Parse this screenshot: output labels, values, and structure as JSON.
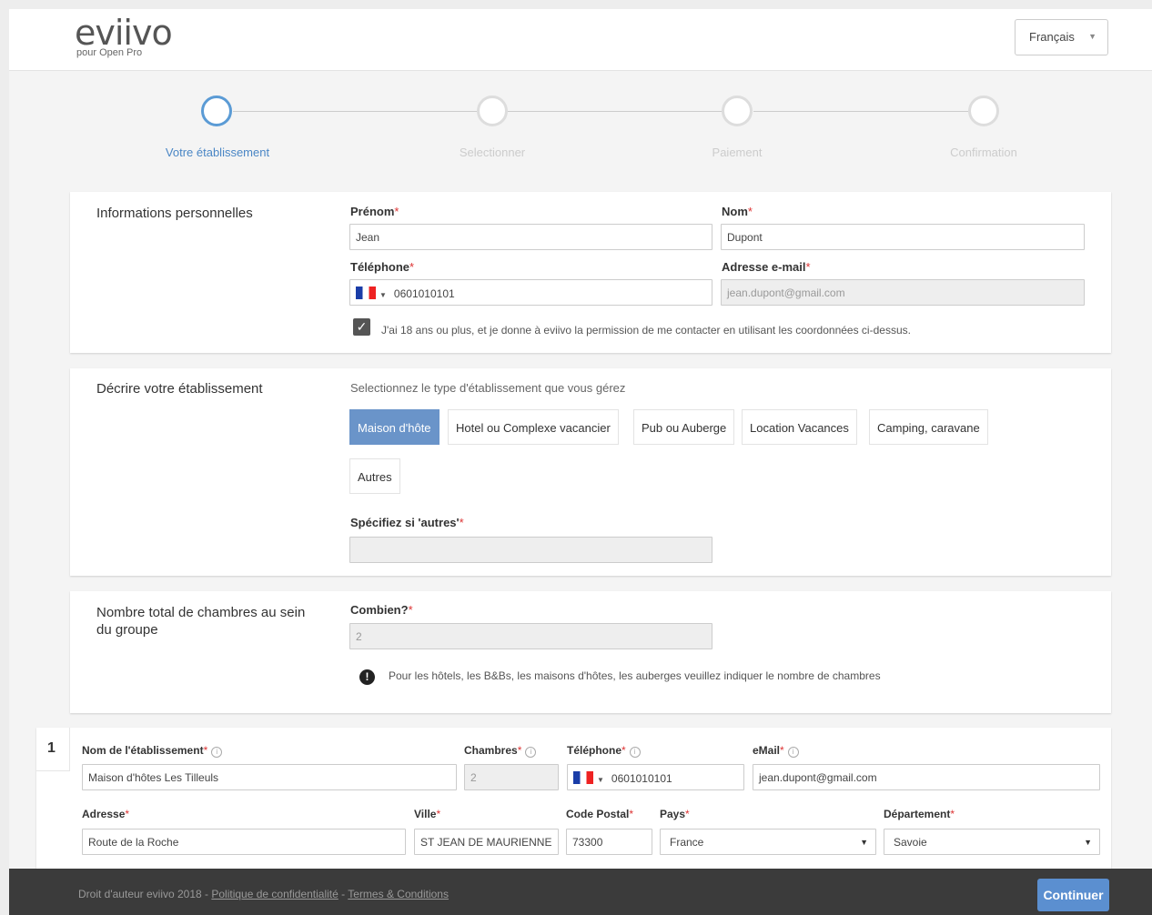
{
  "header": {
    "logo": "eviivo",
    "logo_sub": "pour Open Pro",
    "language": "Français"
  },
  "steps": [
    {
      "label": "Votre établissement",
      "active": true
    },
    {
      "label": "Selectionner",
      "active": false
    },
    {
      "label": "Paiement",
      "active": false
    },
    {
      "label": "Confirmation",
      "active": false
    }
  ],
  "personal": {
    "title": "Informations personnelles",
    "first_name_label": "Prénom",
    "first_name_value": "Jean",
    "last_name_label": "Nom",
    "last_name_value": "Dupont",
    "phone_label": "Téléphone",
    "phone_value": "0601010101",
    "email_label": "Adresse e-mail",
    "email_value": "jean.dupont@gmail.com",
    "consent_text": "J'ai 18 ans ou plus, et je donne à eviivo la permission de me contacter en utilisant les coordonnées ci-dessus.",
    "consent_checked": true
  },
  "establishment": {
    "title": "Décrire votre établissement",
    "prompt": "Selectionnez le type d'établissement que vous gérez",
    "types": [
      "Maison d'hôte",
      "Hotel ou Complexe vacancier",
      "Pub ou Auberge",
      "Location Vacances",
      "Camping, caravane"
    ],
    "other_type": "Autres",
    "selected_type": "Maison d'hôte",
    "specify_label": "Spécifiez si 'autres'",
    "specify_value": ""
  },
  "rooms": {
    "title": "Nombre total de chambres au sein du groupe",
    "count_label": "Combien?",
    "count_value": "2",
    "hint": "Pour les hôtels, les B&Bs, les maisons d'hôtes, les auberges veuillez indiquer le nombre de chambres"
  },
  "property": {
    "index": "1",
    "name_label": "Nom de l'établissement",
    "name_value": "Maison d'hôtes Les Tilleuls",
    "rooms_label": "Chambres",
    "rooms_value": "2",
    "phone_label": "Téléphone",
    "phone_value": "0601010101",
    "email_label": "eMail",
    "email_value": "jean.dupont@gmail.com",
    "address_label": "Adresse",
    "address_value": "Route de la Roche",
    "city_label": "Ville",
    "city_value": "ST JEAN DE MAURIENNE",
    "postal_label": "Code Postal",
    "postal_value": "73300",
    "country_label": "Pays",
    "country_value": "France",
    "dept_label": "Département",
    "dept_value": "Savoie"
  },
  "footer": {
    "copyright": "Droit d'auteur eviivo 2018 - ",
    "privacy": "Politique de confidentialité",
    "sep": " - ",
    "terms": "Termes & Conditions",
    "continue": "Continuer"
  }
}
